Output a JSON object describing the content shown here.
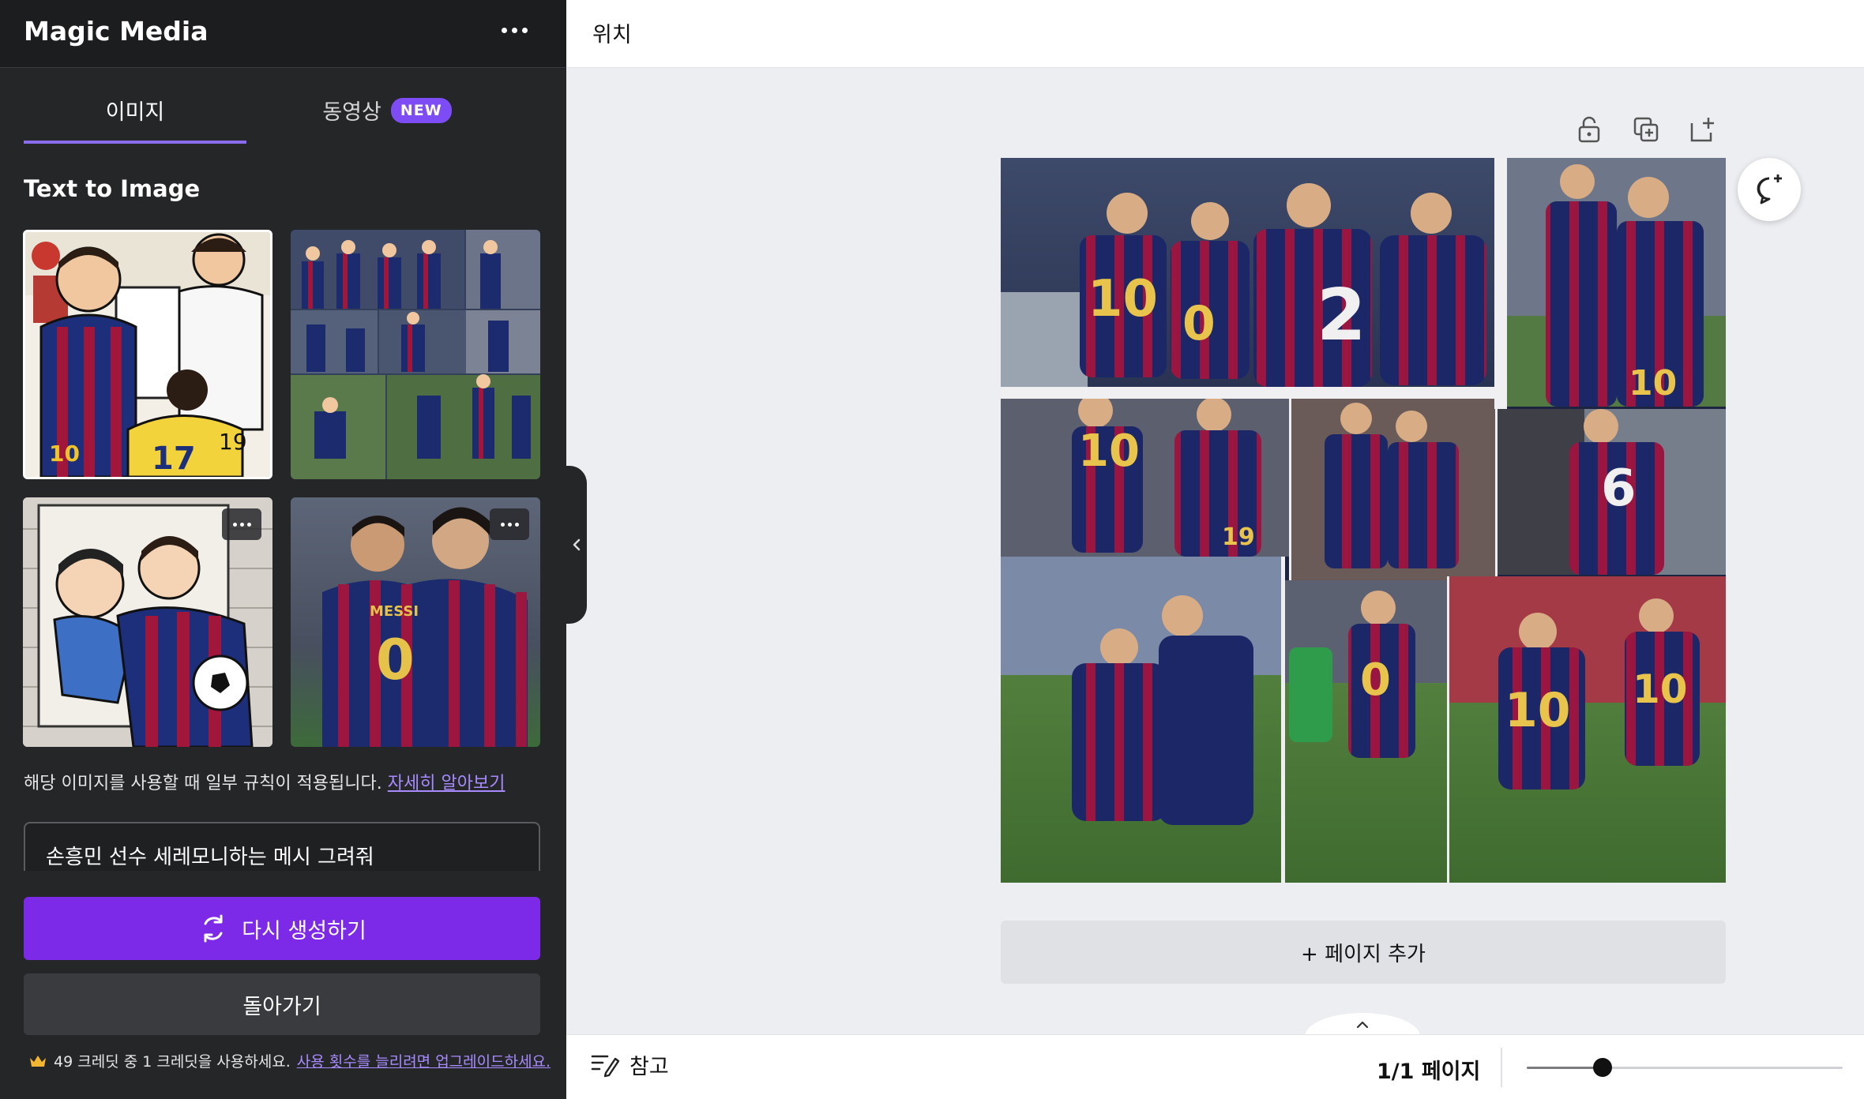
{
  "colors": {
    "accent": "#7d2ae8",
    "link": "#a88bff",
    "panel_bg": "#252628",
    "canvas_bg": "#eceef2"
  },
  "panel": {
    "title": "Magic Media",
    "more_icon": "more-horizontal-icon",
    "tabs": [
      {
        "label": "이미지",
        "active": true
      },
      {
        "label": "동영상",
        "badge": "NEW",
        "active": false
      }
    ],
    "section_title": "Text to Image",
    "thumbnails": [
      {
        "desc": "cartoon-messi-celebration"
      },
      {
        "desc": "collage-barcelona-players"
      },
      {
        "desc": "cartoon-son-messi"
      },
      {
        "desc": "photo-messi-son-hug"
      }
    ],
    "notice": "해당 이미지를 사용할 때 일부 규칙이 적용됩니다.",
    "notice_link": "자세히 알아보기",
    "prompt": "손흥민 선수 세레모니하는 메시 그려줘",
    "regenerate_label": "다시 생성하기",
    "back_label": "돌아가기",
    "credits_text": "49 크레딧 중 1 크레딧을 사용하세요.",
    "credits_link": "사용 횟수를 늘리려면 업그레이드하세요."
  },
  "topbar": {
    "title": "위치"
  },
  "toolbar": {
    "icons": [
      "lock-icon",
      "duplicate-page-icon",
      "add-page-icon"
    ],
    "comment_icon": "add-comment-icon"
  },
  "main": {
    "add_page_label": "+ 페이지 추가"
  },
  "bottombar": {
    "notes_label": "참고",
    "page_indicator": "1/1 페이지",
    "zoom_fraction": 0.24
  }
}
